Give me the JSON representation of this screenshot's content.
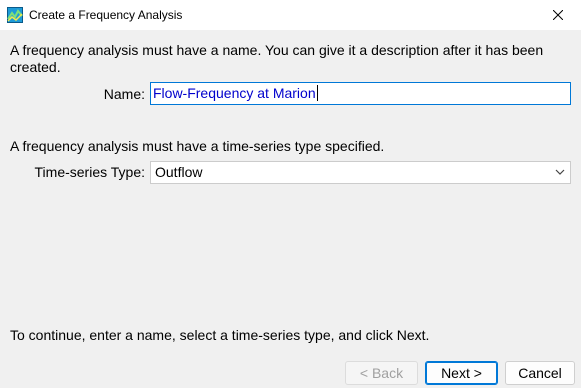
{
  "window": {
    "title": "Create a Frequency Analysis",
    "icon": "frequency-analysis-app-icon"
  },
  "messages": {
    "name_required": "A frequency analysis must have a name. You can give it a description after it has been created.",
    "type_required": "A frequency analysis must have a time-series type specified.",
    "instructions": "To continue, enter a name, select a time-series type, and click Next."
  },
  "form": {
    "name_label": "Name:",
    "name_value": "Flow-Frequency at Marion",
    "ts_type_label": "Time-series Type:",
    "ts_type_value": "Outflow"
  },
  "buttons": {
    "back": "< Back",
    "next": "Next >",
    "cancel": "Cancel"
  },
  "colors": {
    "focus_accent": "#0078d7",
    "selected_text": "#0000cc",
    "disabled_text": "#a0a0a0"
  }
}
